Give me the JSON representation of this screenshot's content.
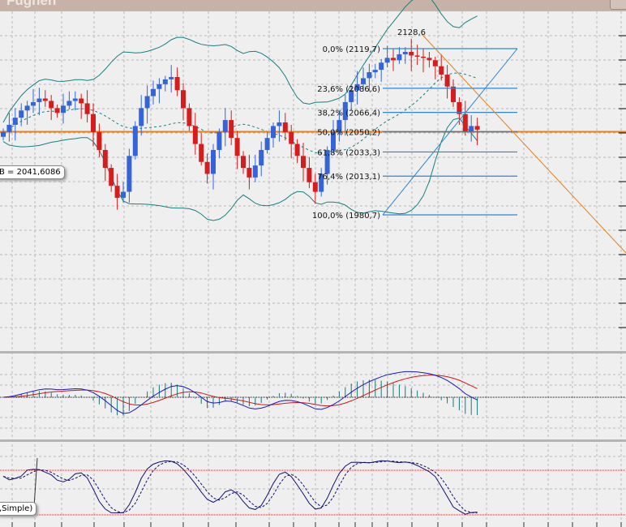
{
  "window": {
    "title": "Fugheh"
  },
  "labels": {
    "bollinger_readout": "B = 2041,6086",
    "stochastic_readout": ",Simple)",
    "high_label": "2128,6"
  },
  "colors": {
    "bull": "#3464d8",
    "bear": "#d61c1c",
    "bands": "#168080",
    "fib": "#2e86d0",
    "orange": "#e8801a",
    "macd": "#1a1ac0",
    "signal": "#d01818",
    "hist": "#187878",
    "stoch": "#101070"
  },
  "chart_data": {
    "type": "candlestick",
    "title": "",
    "ylim": [
      1867.5,
      2150.9
    ],
    "closes": [
      2050,
      2056,
      2062,
      2068,
      2072,
      2075,
      2078,
      2076,
      2070,
      2066,
      2072,
      2076,
      2078,
      2074,
      2065,
      2050,
      2035,
      2020,
      2005,
      1995,
      2000,
      2030,
      2055,
      2070,
      2080,
      2086,
      2090,
      2094,
      2096,
      2085,
      2070,
      2055,
      2040,
      2025,
      2015,
      2035,
      2050,
      2060,
      2045,
      2030,
      2020,
      2012,
      2022,
      2035,
      2045,
      2055,
      2058,
      2050,
      2040,
      2030,
      2020,
      2008,
      2000,
      2015,
      2035,
      2050,
      2060,
      2075,
      2085,
      2090,
      2095,
      2100,
      2102,
      2108,
      2112,
      2110,
      2115,
      2117,
      2114,
      2113,
      2112,
      2110,
      2105,
      2098,
      2088,
      2075,
      2065,
      2050,
      2055,
      2052
    ],
    "current_price": 2050.2,
    "fibonacci": [
      {
        "label": "0,0%",
        "value": "(2119,7)",
        "price": 2119.7
      },
      {
        "label": "23,6%",
        "value": "(2086,6)",
        "price": 2086.6
      },
      {
        "label": "38,2%",
        "value": "(2066,4)",
        "price": 2066.4
      },
      {
        "label": "50,0%",
        "value": "(2050,2)",
        "price": 2050.2
      },
      {
        "label": "61,8%",
        "value": "(2033,3)",
        "price": 2033.3
      },
      {
        "label": "76,4%",
        "value": "(2013,1)",
        "price": 2013.1
      },
      {
        "label": "100,0%",
        "value": "(1980,7)",
        "price": 1980.7
      }
    ],
    "indicators": [
      "Bollinger Bands",
      "MACD",
      "Stochastic"
    ]
  }
}
